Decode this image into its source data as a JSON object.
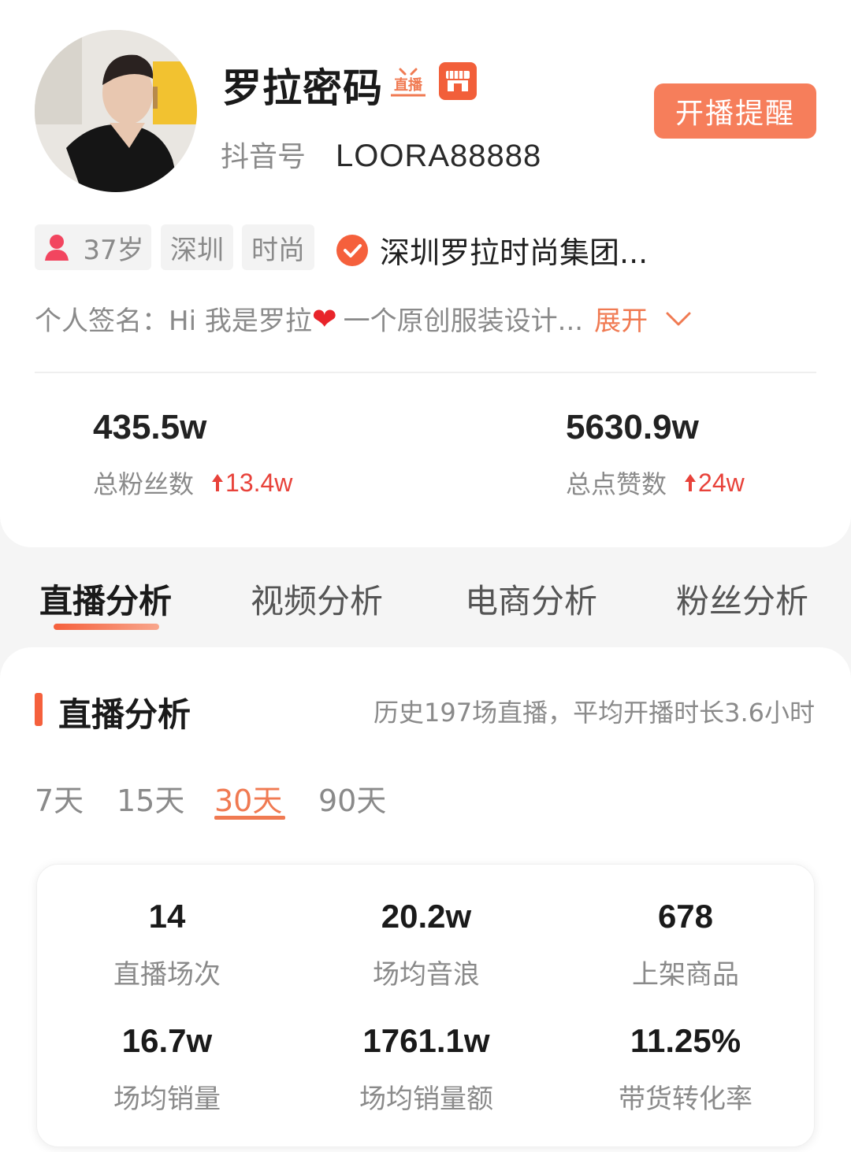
{
  "profile": {
    "name": "罗拉密码",
    "live_badge": "直播",
    "douyin_label": "抖音号",
    "douyin_id": "LOORA88888",
    "remind_button": "开播提醒",
    "tags": {
      "age": "37岁",
      "city": "深圳",
      "style": "时尚"
    },
    "company": "深圳罗拉时尚集团...",
    "signature": {
      "prefix": "个人签名：Hi  我是罗拉",
      "heart": "❤",
      "text": " 一个原创服装设计...",
      "expand": "展开"
    }
  },
  "stats": {
    "fans": {
      "value": "435.5w",
      "label": "总粉丝数",
      "delta": "13.4w"
    },
    "likes": {
      "value": "5630.9w",
      "label": "总点赞数",
      "delta": "24w"
    }
  },
  "tabs": [
    "直播分析",
    "视频分析",
    "电商分析",
    "粉丝分析"
  ],
  "analysis": {
    "title": "直播分析",
    "summary": "历史197场直播，平均开播时长3.6小时",
    "periods": [
      "7天",
      "15天",
      "30天",
      "90天"
    ],
    "selected_period": "30天",
    "metrics": [
      {
        "value": "14",
        "label": "直播场次"
      },
      {
        "value": "20.2w",
        "label": "场均音浪"
      },
      {
        "value": "678",
        "label": "上架商品"
      },
      {
        "value": "16.7w",
        "label": "场均销量"
      },
      {
        "value": "1761.1w",
        "label": "场均销量额"
      },
      {
        "value": "11.25%",
        "label": "带货转化率"
      }
    ]
  },
  "colors": {
    "accent": "#f5603c",
    "button": "#f67e5b",
    "delta_red": "#e8423a",
    "muted": "#8a8a8a"
  }
}
